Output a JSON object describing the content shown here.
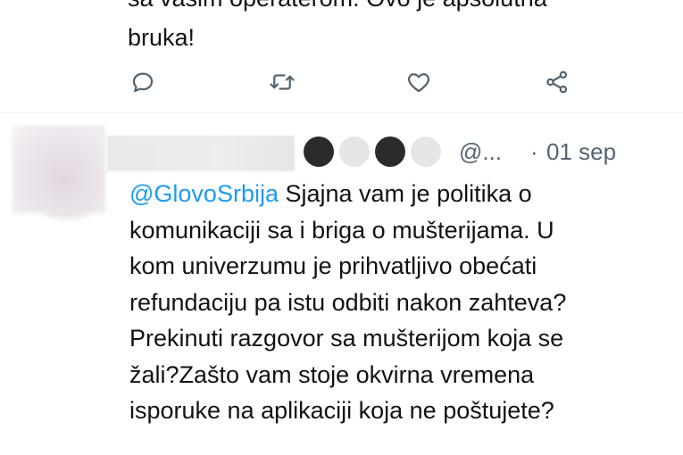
{
  "previous_tweet": {
    "cutoff_text": "sa vašim operaterom. Ovo je apsolutna",
    "last_line": "bruka!"
  },
  "actions": [
    {
      "icon": "reply-icon"
    },
    {
      "icon": "retweet-icon"
    },
    {
      "icon": "like-icon"
    },
    {
      "icon": "share-icon"
    }
  ],
  "reply": {
    "handle": "@...",
    "separator": "·",
    "date": "01 sep",
    "mention": "@GlovoSrbija",
    "text": " Sjajna vam je politika o\nkomunikaciji sa i briga o mušterijama. U\nkom univerzumu je prihvatljivo obećati\nrefundaciju pa istu odbiti nakon zahteva?\nPrekinuti razgovor sa mušterijom koja se\nžali?Zašto vam stoje okvirna vremena\nisporuke na aplikaciji koja ne poštujete?",
    "redaction_dots": [
      "#2b2b2b",
      "#e6e6e6",
      "#2b2b2b",
      "#e6e6e6"
    ]
  },
  "colors": {
    "text": "#0f1419",
    "secondary": "#536471",
    "accent": "#1d9bf0",
    "icon": "#536471"
  }
}
